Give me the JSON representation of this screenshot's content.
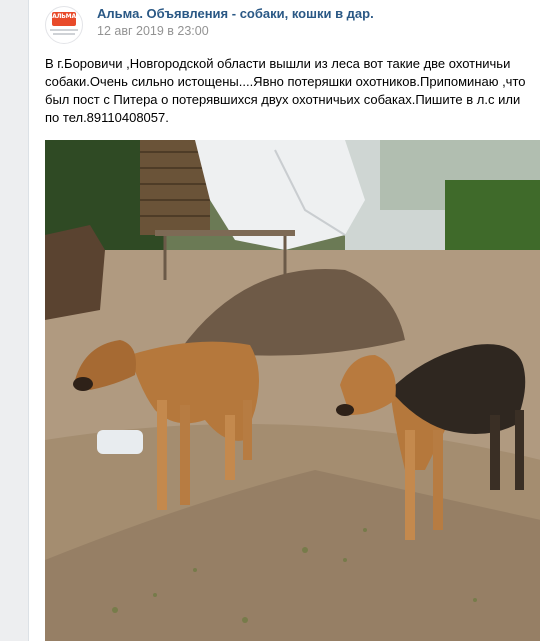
{
  "post": {
    "group_name": "Альма. Объявления - собаки, кошки в дар.",
    "date": "12 авг 2019 в 23:00",
    "text": "В г.Боровичи ,Новгородской области вышли из леса вот такие две охотничьи собаки.Очень сильно истощены....Явно потеряшки охотников.Припоминаю ,что был пост с Питера о потерявшихся двух охотничьих собаках.Пишите в л.с или по тел.89110408057.",
    "avatar_logo": "АЛЬМА",
    "photo_icon": "photo-of-two-hunting-dogs"
  },
  "colors": {
    "link": "#2a5885",
    "meta": "#939393",
    "background": "#edeef0",
    "logo": "#e84a2a"
  }
}
